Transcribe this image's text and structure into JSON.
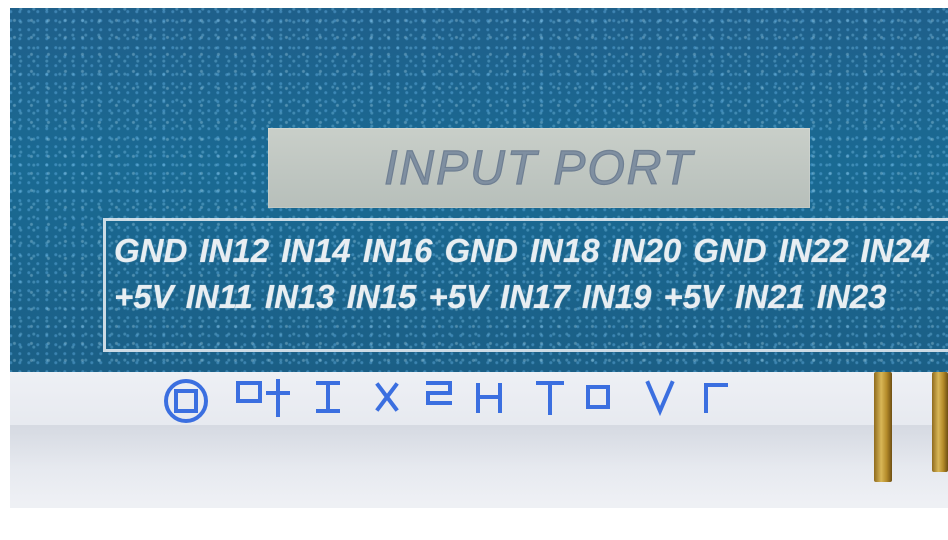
{
  "label_plate": {
    "text": "INPUT PORT"
  },
  "pin_labels": {
    "top_row": [
      "GND",
      "IN12",
      "IN14",
      "IN16",
      "GND",
      "IN18",
      "IN20",
      "GND",
      "IN22",
      "IN24"
    ],
    "bottom_row": [
      "+5V",
      "IN11",
      "IN13",
      "IN15",
      "+5V",
      "IN17",
      "IN19",
      "+5V",
      "IN21",
      "IN23"
    ]
  },
  "colors": {
    "pcb_blue": "#1a6a93",
    "silkscreen_white": "#e8eef2",
    "label_plate_gray": "#bfc6c1",
    "stamp_blue": "#3b6fe0",
    "gold_pin": "#d8b657"
  }
}
